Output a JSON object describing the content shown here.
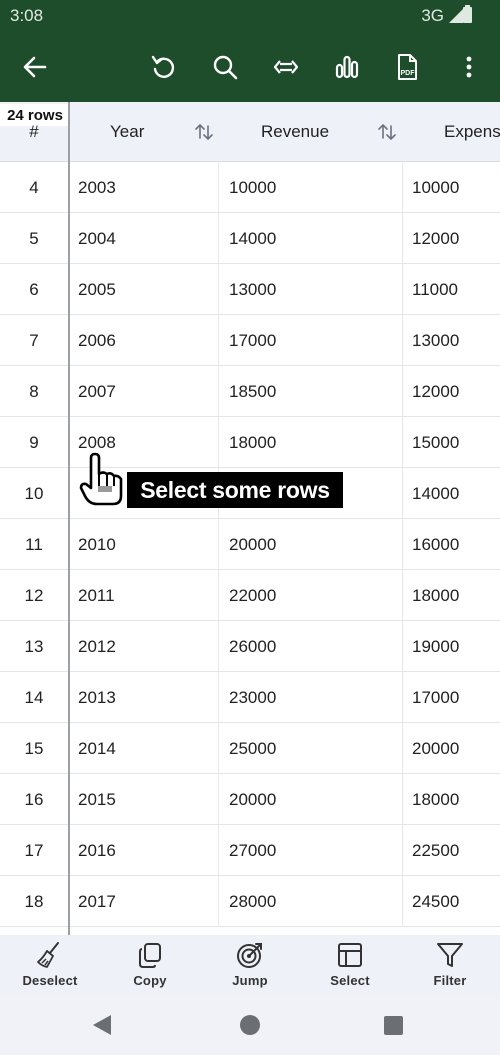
{
  "status_bar": {
    "time": "3:08",
    "network": "3G"
  },
  "toolbar": {
    "icons": [
      "back-arrow-icon",
      "undo-icon",
      "search-icon",
      "fit-width-icon",
      "chart-icon",
      "pdf-icon",
      "more-vert-icon"
    ],
    "pdf_label": "PDF"
  },
  "table": {
    "row_count": "24 rows",
    "headers": {
      "num": "#",
      "year": "Year",
      "revenue": "Revenue",
      "expenses": "Expens"
    },
    "rows": [
      {
        "num": "4",
        "year": "2003",
        "revenue": "10000",
        "expenses": "10000"
      },
      {
        "num": "5",
        "year": "2004",
        "revenue": "14000",
        "expenses": "12000"
      },
      {
        "num": "6",
        "year": "2005",
        "revenue": "13000",
        "expenses": "11000"
      },
      {
        "num": "7",
        "year": "2006",
        "revenue": "17000",
        "expenses": "13000"
      },
      {
        "num": "8",
        "year": "2007",
        "revenue": "18500",
        "expenses": "12000"
      },
      {
        "num": "9",
        "year": "2008",
        "revenue": "18000",
        "expenses": "15000"
      },
      {
        "num": "10",
        "year": "",
        "revenue": "",
        "expenses": "14000"
      },
      {
        "num": "11",
        "year": "2010",
        "revenue": "20000",
        "expenses": "16000"
      },
      {
        "num": "12",
        "year": "2011",
        "revenue": "22000",
        "expenses": "18000"
      },
      {
        "num": "13",
        "year": "2012",
        "revenue": "26000",
        "expenses": "19000"
      },
      {
        "num": "14",
        "year": "2013",
        "revenue": "23000",
        "expenses": "17000"
      },
      {
        "num": "15",
        "year": "2014",
        "revenue": "25000",
        "expenses": "20000"
      },
      {
        "num": "16",
        "year": "2015",
        "revenue": "20000",
        "expenses": "18000"
      },
      {
        "num": "17",
        "year": "2016",
        "revenue": "27000",
        "expenses": "22500"
      },
      {
        "num": "18",
        "year": "2017",
        "revenue": "28000",
        "expenses": "24500"
      }
    ]
  },
  "hint": {
    "text": "Select some rows"
  },
  "actions": [
    {
      "label": "Deselect",
      "icon": "broom-icon"
    },
    {
      "label": "Copy",
      "icon": "copy-icon"
    },
    {
      "label": "Jump",
      "icon": "target-icon"
    },
    {
      "label": "Select",
      "icon": "select-layout-icon"
    },
    {
      "label": "Filter",
      "icon": "filter-icon"
    }
  ],
  "colors": {
    "toolbar": "#1e4d2b",
    "header_bg": "#eef1f7",
    "hint_bg": "#000000"
  }
}
